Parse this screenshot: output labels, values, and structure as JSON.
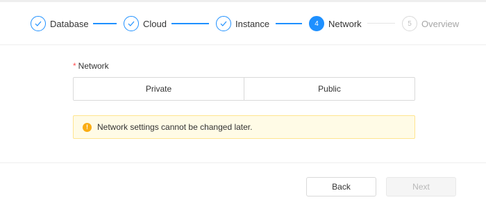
{
  "steps": [
    {
      "label": "Database",
      "status": "done",
      "marker": "check-icon"
    },
    {
      "label": "Cloud",
      "status": "done",
      "marker": "check-icon"
    },
    {
      "label": "Instance",
      "status": "done",
      "marker": "check-icon"
    },
    {
      "label": "Network",
      "status": "active",
      "number": "4"
    },
    {
      "label": "Overview",
      "status": "todo",
      "number": "5"
    }
  ],
  "form": {
    "required_mark": "*",
    "network_label": "Network",
    "options": [
      "Private",
      "Public"
    ]
  },
  "alert": {
    "icon": "warning-icon",
    "icon_glyph": "!",
    "text": "Network settings cannot be changed later."
  },
  "footer": {
    "back_label": "Back",
    "next_label": "Next"
  },
  "colors": {
    "accent": "#1e90ff",
    "warning": "#faad14",
    "required": "#ff4d4f"
  }
}
